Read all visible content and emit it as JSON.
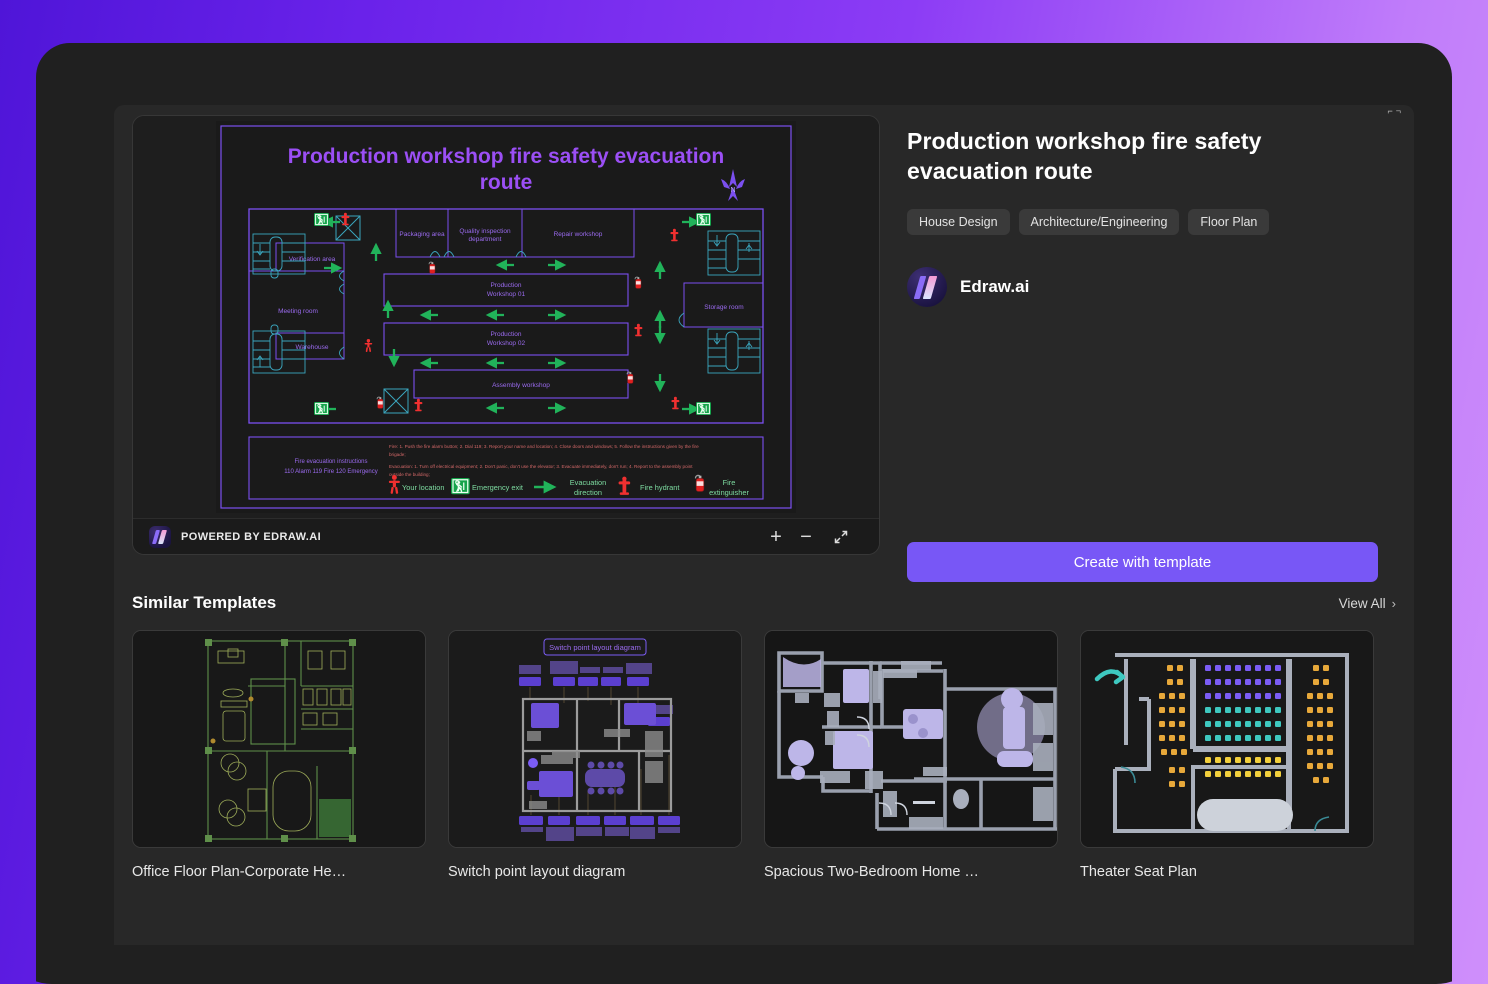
{
  "template": {
    "title": "Production workshop fire safety evacuation route",
    "tags": [
      "House Design",
      "Architecture/Engineering",
      "Floor Plan"
    ],
    "author": "Edraw.ai",
    "cta_label": "Create with template"
  },
  "viewer": {
    "powered_by": "POWERED BY EDRAW.AI",
    "zoom_in": "+",
    "zoom_out": "−",
    "fullscreen_icon": "fullscreen-icon"
  },
  "panel": {
    "corner_glyph": "⌐¬"
  },
  "diagram": {
    "title": "Production workshop fire safety evacuation route",
    "compass": "N",
    "rooms": [
      "Packaging area",
      "Quality inspection department",
      "Repair workshop",
      "Verification area",
      "Meeting room",
      "Warehouse",
      "Storage room",
      "Production Workshop 01",
      "Production Workshop 02",
      "Assembly workshop"
    ],
    "instructions": {
      "heading_line1": "Fire evacuation instructions",
      "heading_line2": "110 Alarm 119 Fire 120 Emergency",
      "fire_text": "Fire: 1. Push the fire alarm button; 2. Dial 119; 3. Report your name and location; 4. Close doors and windows; 5. Follow the instructions given by the fire brigade;",
      "evac_text": "Evacuation: 1. Turn off electrical equipment; 2. Don't panic, don't use the elevator; 3. Evacuate immediately, don't run; 4. Report to the assembly point outside the building;"
    },
    "legend": [
      {
        "label": "Your location",
        "icon": "person-icon",
        "color": "#f03030"
      },
      {
        "label": "Emergency exit",
        "icon": "exit-sign-icon",
        "color": "#17a34a"
      },
      {
        "label": "Evacuation direction",
        "icon": "arrow-right-icon",
        "color": "#21b35a"
      },
      {
        "label": "Fire hydrant",
        "icon": "hydrant-icon",
        "color": "#f03030"
      },
      {
        "label": "Fire extinguisher",
        "icon": "extinguisher-icon",
        "color": "#e02020"
      }
    ],
    "colors": {
      "wall": "#7b4ff0",
      "stairs": "#3ba7bf",
      "arrow": "#21b35a",
      "exit": "#17a34a",
      "fire_red": "#f03030",
      "title": "#9b4ff5"
    }
  },
  "similar": {
    "heading": "Similar Templates",
    "view_all": "View All",
    "cards": [
      {
        "caption": "Office Floor Plan-Corporate He…",
        "thumb": "office-floor-plan-thumb"
      },
      {
        "caption": "Switch point layout diagram",
        "thumb": "switch-point-layout-thumb"
      },
      {
        "caption": "Spacious Two-Bedroom Home …",
        "thumb": "two-bedroom-home-thumb"
      },
      {
        "caption": "Theater Seat Plan",
        "thumb": "theater-seat-plan-thumb"
      }
    ]
  },
  "thumb3_title": "Switch point layout diagram"
}
